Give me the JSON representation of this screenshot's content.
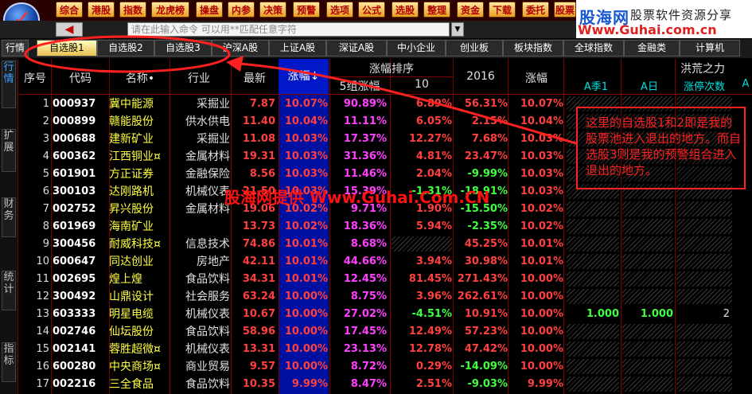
{
  "toolbar": {
    "buttons": [
      "综合",
      "港股",
      "指数",
      "龙虎榜",
      "操盘",
      "内参",
      "决策",
      "预警",
      "选项",
      "公式",
      "选股",
      "整理",
      "资金",
      "下载",
      "委托",
      "股票"
    ]
  },
  "brand": {
    "name": "股海网",
    "tagline": "股票软件资源分享",
    "url": "Www.Guhai.com.cn"
  },
  "command": {
    "placeholder": "请在此输入命令  可以用**匹配任意字符",
    "back": "◀"
  },
  "tabs": {
    "hq": "行情",
    "zx1": "自选股1",
    "zx2": "自选股2",
    "zx3": "自选股3",
    "hs": "沪深A股",
    "sh": "上证A股",
    "sz": "深证A股",
    "zxb": "中小企业",
    "cyb": "创业板",
    "bk": "板块指数",
    "qq": "全球指数",
    "jr": "金融类",
    "jsj": "计算机"
  },
  "rail": {
    "hq": "行情",
    "kz": "扩展",
    "cw": "财务",
    "tj": "统计",
    "zb": "指标"
  },
  "headers": {
    "no": "序号",
    "code": "代码",
    "name": "名称•",
    "industry": "行业",
    "latest": "最新",
    "zf": "涨幅↓",
    "group": "涨幅排序",
    "g5": "5组涨幅",
    "d10": "10",
    "y2016": "2016",
    "zf2": "涨幅",
    "hongfang": "洪荒之力",
    "a_quarter": "A季1",
    "a_day": "A日",
    "limit_count": "涨停次数",
    "a_more": "A"
  },
  "rows": [
    {
      "no": "1",
      "code": "000937",
      "name": "冀中能源",
      "ind": "采掘业",
      "price": "7.87",
      "zf": "10.07%",
      "g5": "90.89%",
      "d10": "6.89%",
      "y2016": "56.31%",
      "zf2": "10.07%",
      "a1": "",
      "ad": "",
      "zt": ""
    },
    {
      "no": "2",
      "code": "000899",
      "name": "赣能股份",
      "ind": "供水供电",
      "price": "11.40",
      "zf": "10.04%",
      "g5": "11.11%",
      "d10": "6.05%",
      "y2016": "2.15%",
      "zf2": "10.04%",
      "a1": "",
      "ad": "",
      "zt": ""
    },
    {
      "no": "3",
      "code": "000688",
      "name": "建新矿业",
      "ind": "采掘业",
      "price": "11.08",
      "zf": "10.03%",
      "g5": "17.37%",
      "d10": "12.27%",
      "y2016": "7.68%",
      "zf2": "10.03%",
      "a1": "",
      "ad": "",
      "zt": ""
    },
    {
      "no": "4",
      "code": "600362",
      "name": "江西铜业¤",
      "ind": "金属材料",
      "price": "19.31",
      "zf": "10.03%",
      "g5": "31.36%",
      "d10": "4.81%",
      "y2016": "23.47%",
      "zf2": "10.03%",
      "a1": "",
      "ad": "",
      "zt": ""
    },
    {
      "no": "5",
      "code": "601901",
      "name": "方正证券",
      "ind": "金融保险",
      "price": "8.56",
      "zf": "10.03%",
      "g5": "11.46%",
      "d10": "2.04%",
      "y2016": "-9.99%",
      "zf2": "10.03%",
      "a1": "",
      "ad": "",
      "zt": ""
    },
    {
      "no": "6",
      "code": "300103",
      "name": "达刚路机",
      "ind": "机械仪表",
      "price": "21.50",
      "zf": "10.03%",
      "g5": "15.39%",
      "d10": "-1.31%",
      "y2016": "-18.91%",
      "zf2": "10.03%",
      "a1": "",
      "ad": "",
      "zt": ""
    },
    {
      "no": "7",
      "code": "002752",
      "name": "昇兴股份",
      "ind": "金属材料",
      "price": "19.06",
      "zf": "10.02%",
      "g5": "9.71%",
      "d10": "1.90%",
      "y2016": "-15.50%",
      "zf2": "10.02%",
      "a1": "",
      "ad": "",
      "zt": ""
    },
    {
      "no": "8",
      "code": "601969",
      "name": "海南矿业",
      "ind": "",
      "price": "13.73",
      "zf": "10.02%",
      "g5": "18.36%",
      "d10": "5.94%",
      "y2016": "-2.35%",
      "zf2": "10.02%",
      "a1": "",
      "ad": "",
      "zt": ""
    },
    {
      "no": "9",
      "code": "300456",
      "name": "耐威科技¤",
      "ind": "信息技术",
      "price": "74.86",
      "zf": "10.01%",
      "g5": "8.68%",
      "d10": "",
      "y2016": "45.25%",
      "zf2": "10.01%",
      "a1": "",
      "ad": "",
      "zt": ""
    },
    {
      "no": "10",
      "code": "600647",
      "name": "同达创业",
      "ind": "房地产",
      "price": "42.11",
      "zf": "10.01%",
      "g5": "44.66%",
      "d10": "3.94%",
      "y2016": "30.98%",
      "zf2": "10.01%",
      "a1": "",
      "ad": "",
      "zt": ""
    },
    {
      "no": "11",
      "code": "002695",
      "name": "煌上煌",
      "ind": "食品饮料",
      "price": "34.31",
      "zf": "10.01%",
      "g5": "12.45%",
      "d10": "81.45%",
      "y2016": "271.43%",
      "zf2": "10.00%",
      "a1": "",
      "ad": "",
      "zt": ""
    },
    {
      "no": "12",
      "code": "300492",
      "name": "山鼎设计",
      "ind": "社会服务",
      "price": "63.24",
      "zf": "10.00%",
      "g5": "8.75%",
      "d10": "3.96%",
      "y2016": "262.61%",
      "zf2": "10.00%",
      "a1": "",
      "ad": "",
      "zt": ""
    },
    {
      "no": "13",
      "code": "603333",
      "name": "明星电缆",
      "ind": "机械仪表",
      "price": "10.67",
      "zf": "10.00%",
      "g5": "27.02%",
      "d10": "-4.51%",
      "y2016": "10.91%",
      "zf2": "10.00%",
      "a1": "1.000",
      "ad": "1.000",
      "zt": "2"
    },
    {
      "no": "14",
      "code": "002746",
      "name": "仙坛股份",
      "ind": "食品饮料",
      "price": "58.96",
      "zf": "10.00%",
      "g5": "17.45%",
      "d10": "12.49%",
      "y2016": "57.23%",
      "zf2": "10.00%",
      "a1": "",
      "ad": "",
      "zt": ""
    },
    {
      "no": "15",
      "code": "002141",
      "name": "蓉胜超微¤",
      "ind": "机械仪表",
      "price": "13.31",
      "zf": "10.00%",
      "g5": "23.13%",
      "d10": "12.78%",
      "y2016": "47.42%",
      "zf2": "10.00%",
      "a1": "",
      "ad": "",
      "zt": ""
    },
    {
      "no": "16",
      "code": "600280",
      "name": "中央商场¤",
      "ind": "商业贸易",
      "price": "9.57",
      "zf": "10.00%",
      "g5": "8.72%",
      "d10": "0.29%",
      "y2016": "-14.09%",
      "zf2": "10.00%",
      "a1": "",
      "ad": "",
      "zt": ""
    },
    {
      "no": "17",
      "code": "002216",
      "name": "三全食品",
      "ind": "食品饮料",
      "price": "10.35",
      "zf": "9.99%",
      "g5": "8.47%",
      "d10": "2.51%",
      "y2016": "-9.03%",
      "zf2": "9.99%",
      "a1": "",
      "ad": "",
      "zt": ""
    }
  ],
  "annotation": {
    "note": "这里的自选股1和2即是我的股票池进入退出的地方。而自选股3则是我的预警组合进入退出的地方。",
    "watermark": "股海网提供 Www.Guhai.Com.CN"
  },
  "colors": {
    "up": "#ff4040",
    "down": "#40ff40",
    "accent_blue": "#0018c8",
    "border_red": "#800000"
  }
}
